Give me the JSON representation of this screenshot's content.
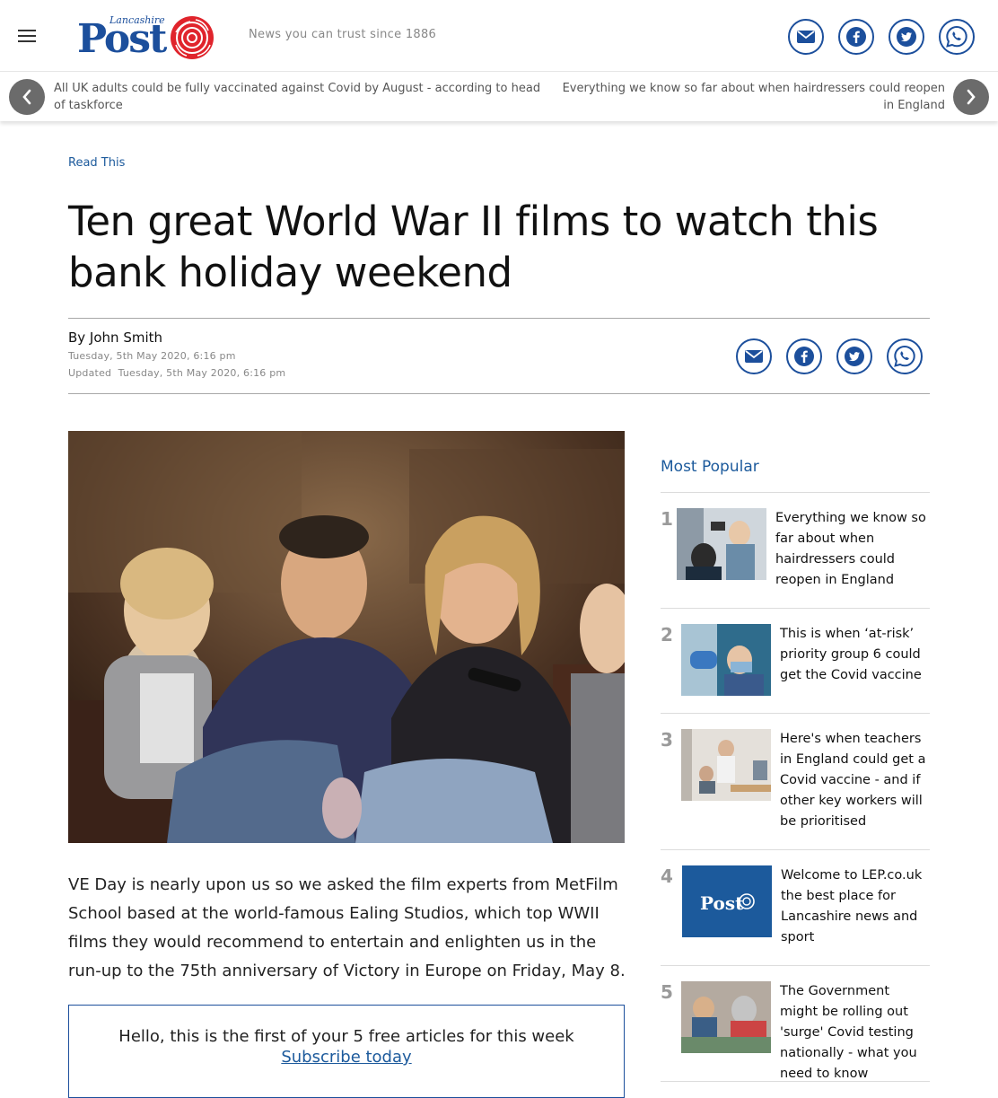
{
  "header": {
    "logo_small": "Lancashire",
    "logo_main": "Post",
    "tagline": "News you can trust since 1886",
    "share_icons": [
      "email-icon",
      "facebook-icon",
      "twitter-icon",
      "whatsapp-icon"
    ]
  },
  "ticker": {
    "left": "All UK adults could be fully vaccinated against Covid by August - according to head of taskforce",
    "right": "Everything we know so far about when hairdressers could reopen in England"
  },
  "article": {
    "section": "Read This",
    "headline": "Ten great World War II films to watch this bank holiday weekend",
    "byline": "By John Smith",
    "published": "Tuesday, 5th May 2020, 6:16 pm",
    "updated_label": "Updated",
    "updated": "Tuesday, 5th May 2020, 6:16 pm",
    "body": "VE Day is nearly upon us so we asked the film experts from MetFilm School based at the world-famous Ealing Studios, which top WWII films they would recommend to entertain and enlighten us in the run-up to the 75th anniversary of Victory in Europe on Friday, May 8."
  },
  "paywall": {
    "message": "Hello, this is the first of your 5 free articles for this week",
    "link": "Subscribe today"
  },
  "most_popular": {
    "title": "Most Popular",
    "items": [
      {
        "num": "1",
        "text": "Everything we know so far about when hairdressers could reopen in England"
      },
      {
        "num": "2",
        "text": "This is when ‘at-risk’ priority group 6 could get the Covid vaccine"
      },
      {
        "num": "3",
        "text": "Here's when teachers in England could get a Covid vaccine - and if other key workers will be prioritised"
      },
      {
        "num": "4",
        "text": "Welcome to LEP.co.uk the best place for Lancashire news and sport"
      },
      {
        "num": "5",
        "text": "The Government might be rolling out 'surge' Covid testing nationally - what you need to know"
      }
    ]
  },
  "colors": {
    "brand": "#1c4f9c",
    "link": "#1c5a9c",
    "rose": "#e0242c"
  }
}
